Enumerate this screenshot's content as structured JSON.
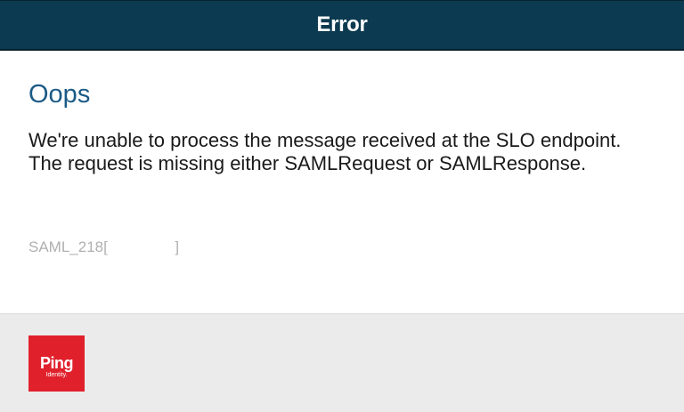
{
  "header": {
    "title": "Error"
  },
  "main": {
    "heading": "Oops",
    "message": "We're unable to process the message received at the SLO endpoint. The request is missing either SAMLRequest or SAMLResponse.",
    "error_code": "SAML_218[                ]"
  },
  "footer": {
    "logo": {
      "text": "Ping",
      "subtext": "Identity.",
      "color": "#e0212c"
    }
  },
  "colors": {
    "header_background": "#0c3a50",
    "heading": "#1b5a86",
    "footer_background": "#ebebeb"
  }
}
